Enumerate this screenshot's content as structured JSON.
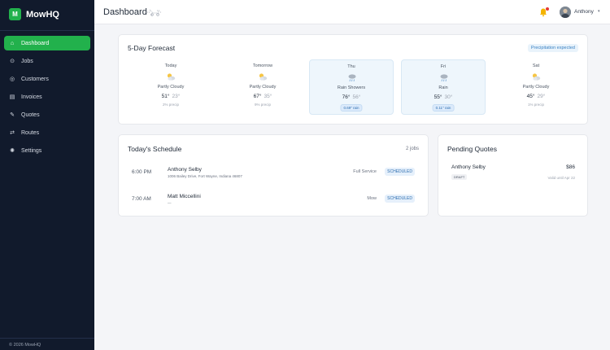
{
  "app": {
    "brand_letter": "M",
    "brand_name": "MowHQ",
    "footer": "© 2026 MowHQ"
  },
  "sidebar": {
    "items": [
      {
        "label": "Dashboard",
        "icon": "home-icon",
        "active": true
      },
      {
        "label": "Jobs",
        "icon": "jobs-icon",
        "active": false
      },
      {
        "label": "Customers",
        "icon": "customers-icon",
        "active": false
      },
      {
        "label": "Invoices",
        "icon": "invoices-icon",
        "active": false
      },
      {
        "label": "Quotes",
        "icon": "quotes-icon",
        "active": false
      },
      {
        "label": "Routes",
        "icon": "routes-icon",
        "active": false
      },
      {
        "label": "Settings",
        "icon": "settings-icon",
        "active": false
      }
    ]
  },
  "header": {
    "title": "Dashboard",
    "user_name": "Anthony"
  },
  "forecast": {
    "title": "5-Day Forecast",
    "badge": "Precipitation expected",
    "days": [
      {
        "name": "Today",
        "condition": "Partly Cloudy",
        "icon": "partly-cloudy-icon",
        "high": "51°",
        "low": "23°",
        "precip": "2% precip",
        "rain": false
      },
      {
        "name": "Tomorrow",
        "condition": "Partly Cloudy",
        "icon": "partly-cloudy-icon",
        "high": "67°",
        "low": "35°",
        "precip": "9% precip",
        "rain": false
      },
      {
        "name": "Thu",
        "condition": "Rain Showers",
        "icon": "rain-icon",
        "high": "76°",
        "low": "56°",
        "precip": "0.69\" rain",
        "rain": true
      },
      {
        "name": "Fri",
        "condition": "Rain",
        "icon": "rain-icon",
        "high": "55°",
        "low": "30°",
        "precip": "0.11\" rain",
        "rain": true
      },
      {
        "name": "Sat",
        "condition": "Partly Cloudy",
        "icon": "partly-cloudy-icon",
        "high": "45°",
        "low": "29°",
        "precip": "1% precip",
        "rain": false
      }
    ]
  },
  "schedule": {
    "title": "Today's Schedule",
    "count": "2 jobs",
    "jobs": [
      {
        "time": "6:00 PM",
        "client": "Anthony Selby",
        "address": "1006 Bailey Drive, Fort Wayne, Indiana 46807",
        "service": "Full Service",
        "status": "SCHEDULED"
      },
      {
        "time": "7:00 AM",
        "client": "Matt Miccellini",
        "address": "—",
        "service": "Mow",
        "status": "SCHEDULED"
      }
    ]
  },
  "quotes": {
    "title": "Pending Quotes",
    "items": [
      {
        "client": "Anthony Selby",
        "amount": "$86",
        "status": "DRAFT",
        "valid": "Valid until Apr 22"
      }
    ]
  },
  "colors": {
    "brand_green": "#22b14c",
    "sidebar_bg": "#111a2c",
    "status_blue": "#2e6fb0",
    "notification_red": "#e53935"
  }
}
